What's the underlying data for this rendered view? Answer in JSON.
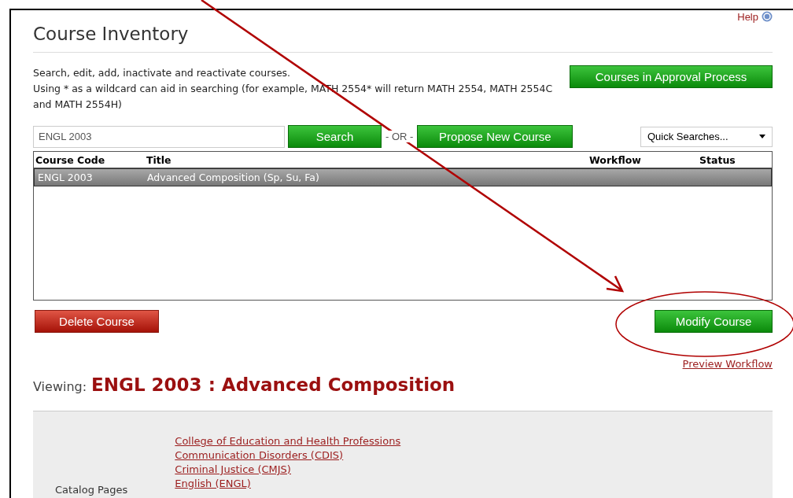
{
  "help": {
    "label": "Help"
  },
  "title": "Course Inventory",
  "intro": [
    "Search, edit, add, inactivate and reactivate courses.",
    "Using * as a wildcard can aid in searching (for example, MATH 2554* will return MATH 2554, MATH 2554C and MATH 2554H)"
  ],
  "approval_button": "Courses in Approval Process",
  "search": {
    "value": "ENGL 2003",
    "button": "Search",
    "separator": "- OR -",
    "propose_button": "Propose New Course",
    "quick_searches": "Quick Searches..."
  },
  "table": {
    "columns": [
      "Course Code",
      "Title",
      "Workflow",
      "Status"
    ],
    "rows": [
      {
        "code": "ENGL 2003",
        "title": "Advanced Composition (Sp, Su, Fa)",
        "selected": true
      }
    ]
  },
  "delete_button": "Delete Course",
  "modify_button": "Modify Course",
  "preview_link": "Preview Workflow",
  "viewing": {
    "label": "Viewing:",
    "course": "ENGL 2003 : Advanced Composition"
  },
  "catalog": {
    "label": "Catalog Pages",
    "links": [
      "College of Education and Health Professions",
      "Communication Disorders (CDIS)",
      "Criminal Justice (CMJS)",
      "English (ENGL)"
    ]
  }
}
